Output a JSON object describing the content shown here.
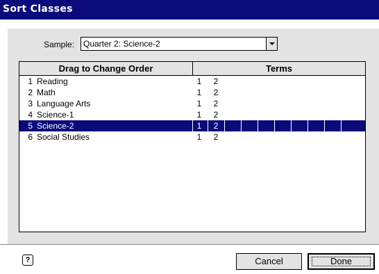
{
  "window": {
    "title": "Sort Classes"
  },
  "sample": {
    "label": "Sample:",
    "value": "Quarter 2: Science-2"
  },
  "list": {
    "headers": {
      "order": "Drag to Change Order",
      "terms": "Terms"
    },
    "rows": [
      {
        "num": "1",
        "name": "Reading",
        "t1": "1",
        "t2": "2"
      },
      {
        "num": "2",
        "name": "Math",
        "t1": "1",
        "t2": "2"
      },
      {
        "num": "3",
        "name": "Language Arts",
        "t1": "1",
        "t2": "2"
      },
      {
        "num": "4",
        "name": "Science-1",
        "t1": "1",
        "t2": "2"
      },
      {
        "num": "5",
        "name": "Science-2",
        "t1": "1",
        "t2": "2"
      },
      {
        "num": "6",
        "name": "Social Studies",
        "t1": "1",
        "t2": "2"
      }
    ],
    "selected_index": 4
  },
  "buttons": {
    "help": "?",
    "cancel": "Cancel",
    "done": "Done"
  },
  "icons": {
    "help": "question-icon",
    "dropdown": "chevron-down-icon"
  },
  "colors": {
    "titlebar": "#0a0a7a",
    "selection": "#0a0a7a",
    "panel": "#e3e3e3"
  }
}
